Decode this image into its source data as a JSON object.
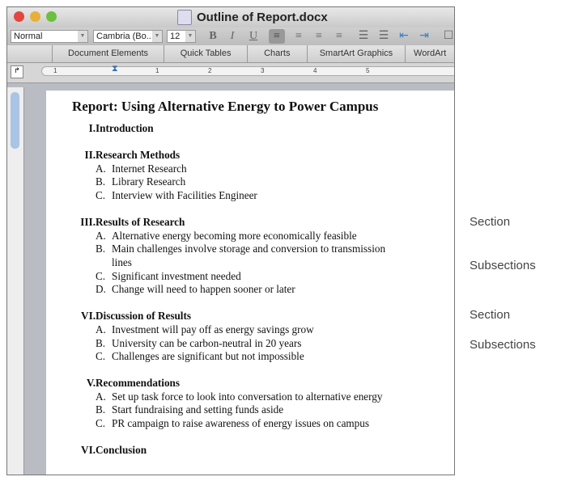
{
  "window": {
    "title": "Outline of Report.docx"
  },
  "toolbar": {
    "style": "Normal",
    "font": "Cambria (Bo...",
    "size": "12",
    "bold": "B",
    "italic": "I",
    "underline": "U"
  },
  "tabs": [
    "Document Elements",
    "Quick Tables",
    "Charts",
    "SmartArt Graphics",
    "WordArt"
  ],
  "ruler": {
    "marks": [
      "1",
      "1",
      "2",
      "3",
      "4",
      "5"
    ]
  },
  "document": {
    "title": "Report: Using Alternative Energy to Power Campus",
    "sections": [
      {
        "num": "I.",
        "label": "Introduction",
        "items": []
      },
      {
        "num": "II.",
        "label": "Research Methods",
        "items": [
          {
            "num": "A.",
            "text": "Internet Research"
          },
          {
            "num": "B.",
            "text": "Library Research"
          },
          {
            "num": "C.",
            "text": "Interview with Facilities Engineer"
          }
        ]
      },
      {
        "num": "III.",
        "label": "Results of Research",
        "items": [
          {
            "num": "A.",
            "text": "Alternative energy becoming more economically feasible"
          },
          {
            "num": "B.",
            "text": "Main challenges involve storage and conversion to transmission lines"
          },
          {
            "num": "C.",
            "text": "Significant investment needed"
          },
          {
            "num": "D.",
            "text": "Change will need to happen sooner or later"
          }
        ]
      },
      {
        "num": "VI.",
        "label": "Discussion of Results",
        "items": [
          {
            "num": "A.",
            "text": "Investment will pay off as energy savings grow"
          },
          {
            "num": "B.",
            "text": "University can be carbon-neutral in 20 years"
          },
          {
            "num": "C.",
            "text": "Challenges are significant but not impossible"
          }
        ]
      },
      {
        "num": "V.",
        "label": "Recommendations",
        "items": [
          {
            "num": "A.",
            "text": "Set up task force to look into conversation to alternative energy"
          },
          {
            "num": "B.",
            "text": "Start fundraising and setting funds aside"
          },
          {
            "num": "C.",
            "text": "PR campaign to raise awareness of energy issues on campus"
          }
        ]
      },
      {
        "num": "VI.",
        "label": "Conclusion",
        "items": []
      }
    ]
  },
  "annotations": [
    "Section",
    "Subsections",
    "Section",
    "Subsections"
  ]
}
